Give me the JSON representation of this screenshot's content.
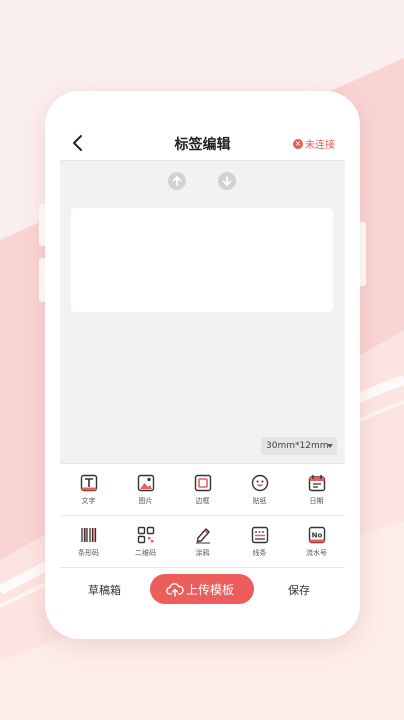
{
  "colors": {
    "accent": "#ec5e5b",
    "background": "#fbeeee",
    "screen": "#f2f2f2"
  },
  "header": {
    "back_icon": "chevron-left-icon",
    "title": "标签编辑",
    "connection_status": "未连接",
    "status_icon": "close-circle-icon"
  },
  "canvas_controls": {
    "up_icon": "arrow-up-circle-icon",
    "down_icon": "arrow-down-circle-icon"
  },
  "label_size": {
    "selected": "30mm*12mm"
  },
  "tools_row1": [
    {
      "label": "文字",
      "icon": "text-icon"
    },
    {
      "label": "图片",
      "icon": "image-icon"
    },
    {
      "label": "边框",
      "icon": "border-icon"
    },
    {
      "label": "贴纸",
      "icon": "sticker-icon"
    },
    {
      "label": "日期",
      "icon": "calendar-icon"
    }
  ],
  "tools_row2": [
    {
      "label": "条形码",
      "icon": "barcode-icon"
    },
    {
      "label": "二维码",
      "icon": "qrcode-icon"
    },
    {
      "label": "涂鸦",
      "icon": "pen-icon"
    },
    {
      "label": "线条",
      "icon": "line-icon"
    },
    {
      "label": "流水号",
      "icon": "serial-number-icon"
    }
  ],
  "serial_icon_text": "No",
  "bottom": {
    "drafts": "草稿箱",
    "upload": "上传模板",
    "save": "保存"
  }
}
